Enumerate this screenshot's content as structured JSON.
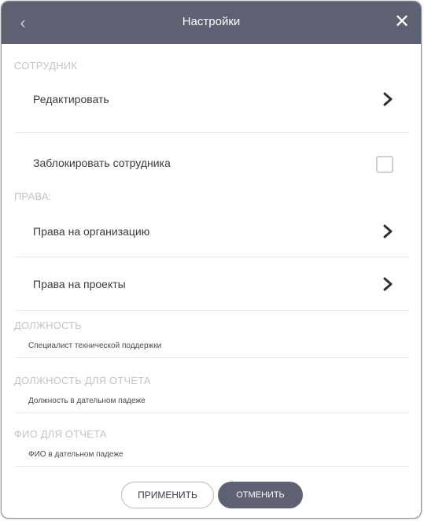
{
  "header": {
    "title": "Настройки",
    "back_icon": "chevron-left-icon",
    "close_icon": "close-icon"
  },
  "sections": {
    "employee_label": "СОТРУДНИК",
    "edit_label": "Редактировать",
    "block_label": "Заблокировать сотрудника",
    "block_checked": false,
    "rights_label": "ПРАВА:",
    "org_rights_label": "Права на организацию",
    "project_rights_label": "Права на проекты",
    "position_label": "ДОЛЖНОСТЬ",
    "position_value": "Специалист технической поддержки",
    "report_position_label": "ДОЛЖНОСТЬ ДЛЯ ОТЧЕТА",
    "report_position_value": "Должность в дательном падеже",
    "report_name_label": "ФИО ДЛЯ ОТЧЕТА",
    "report_name_value": "ФИО в дательном падеже"
  },
  "footer": {
    "apply_label": "ПРИМЕНИТЬ",
    "cancel_label": "ОТМЕНИТЬ"
  },
  "colors": {
    "header_bg": "#5e6172",
    "section_label": "#c4c4c8",
    "text": "#3a3a40"
  }
}
